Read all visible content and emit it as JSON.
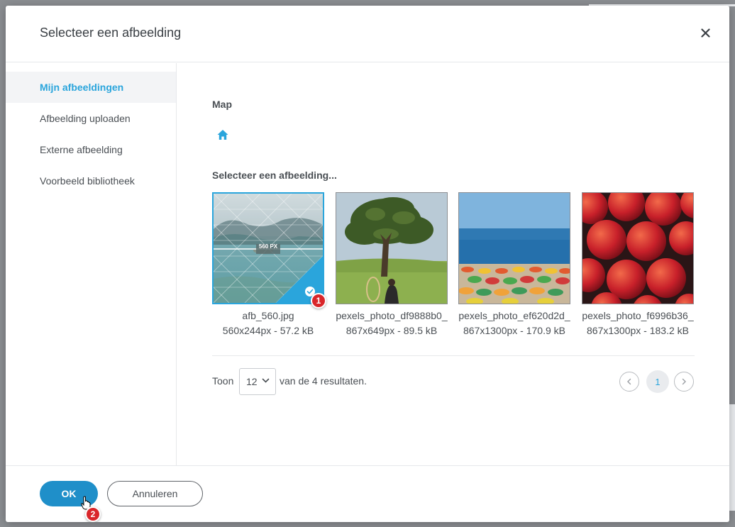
{
  "dialog": {
    "title": "Selecteer een afbeelding",
    "close_icon": "close-icon"
  },
  "sidebar": {
    "items": [
      {
        "label": "Mijn afbeeldingen",
        "active": true
      },
      {
        "label": "Afbeelding uploaden",
        "active": false
      },
      {
        "label": "Externe afbeelding",
        "active": false
      },
      {
        "label": "Voorbeeld bibliotheek",
        "active": false
      }
    ]
  },
  "main": {
    "folder_label": "Map",
    "folder_icon": "home-icon",
    "select_label": "Selecteer een afbeelding...",
    "images": [
      {
        "name": "afb_560.jpg",
        "meta": "560x244px - 57.2 kB",
        "selected": true,
        "overlay_text": "560 PX",
        "badge": "1"
      },
      {
        "name": "pexels_photo_df9888b0_",
        "meta": "867x649px - 89.5 kB",
        "selected": false
      },
      {
        "name": "pexels_photo_ef620d2d_",
        "meta": "867x1300px - 170.9 kB",
        "selected": false
      },
      {
        "name": "pexels_photo_f6996b36_",
        "meta": "867x1300px - 183.2 kB",
        "selected": false
      }
    ]
  },
  "pagination": {
    "show_label": "Toon",
    "per_page": "12",
    "results_text": "van de 4 resultaten.",
    "current_page": "1"
  },
  "footer": {
    "ok_label": "OK",
    "cancel_label": "Annuleren",
    "ok_badge": "2"
  },
  "colors": {
    "accent": "#2aa5dc",
    "primary_button": "#1f8fc9",
    "badge": "#d9262a"
  }
}
